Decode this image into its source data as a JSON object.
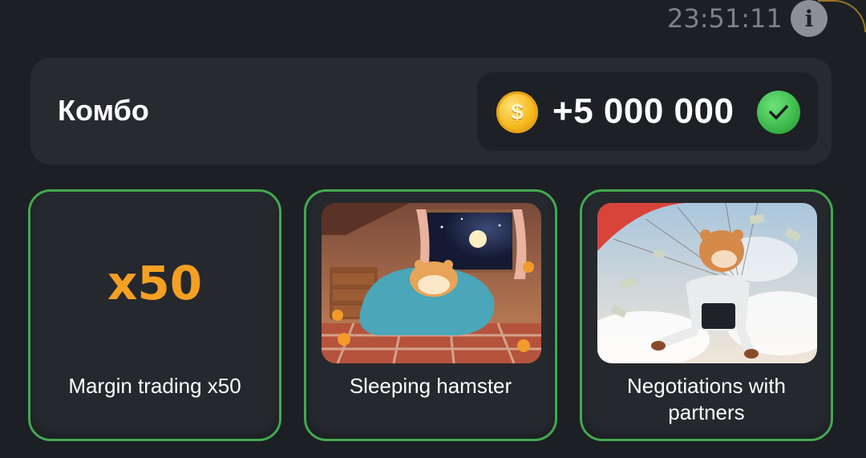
{
  "header": {
    "timer": "23:51:11",
    "info_icon": "info-icon"
  },
  "combo": {
    "title": "Комбо",
    "reward": "+5 000 000",
    "coin_icon": "coin-icon",
    "coin_symbol": "$",
    "status_icon": "check-circle-icon"
  },
  "cards": [
    {
      "label": "Margin trading x50",
      "multiplier": "x50",
      "image": "none"
    },
    {
      "label": "Sleeping hamster",
      "image": "sleeping-hamster-illustration"
    },
    {
      "label": "Negotiations with partners",
      "image": "parachuting-hamster-illustration"
    }
  ],
  "colors": {
    "background": "#1c1f24",
    "panel": "#272a2f",
    "card_border": "#43a84f",
    "accent_orange": "#f5a023",
    "check_green": "#3cb94a",
    "coin_gold": "#f6b91e"
  }
}
